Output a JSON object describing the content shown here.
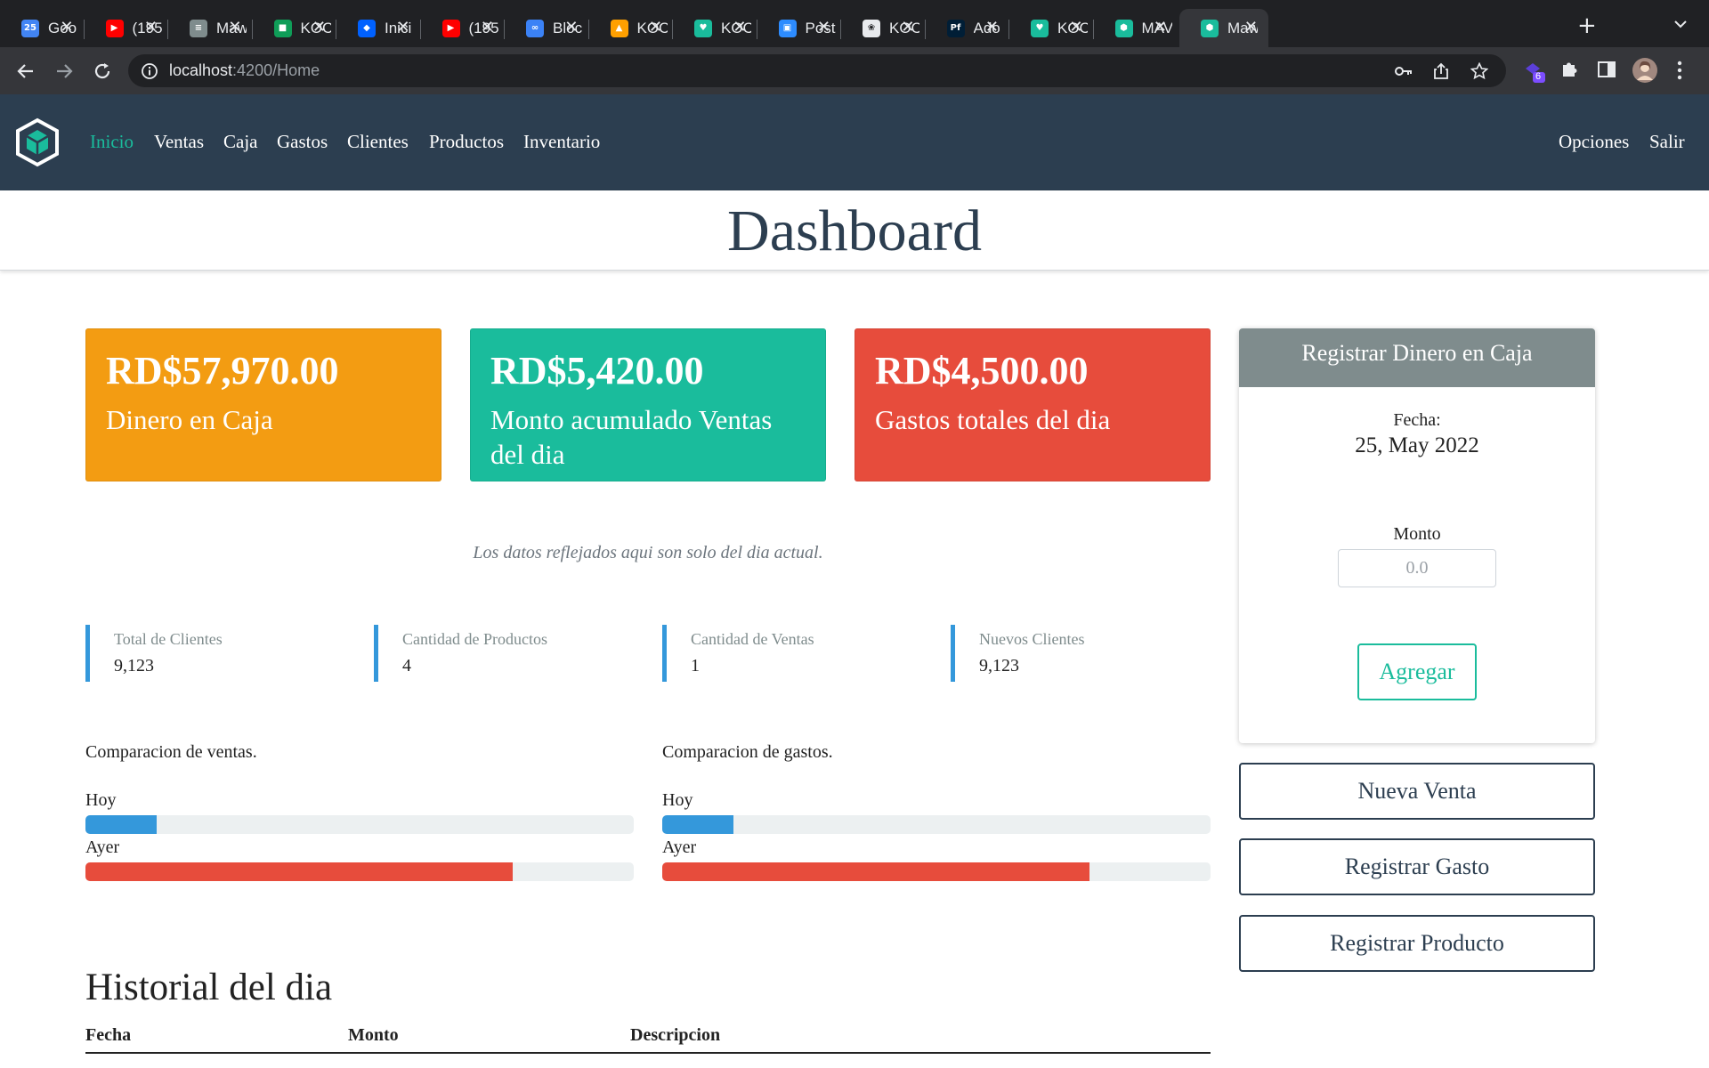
{
  "browser": {
    "tabs": [
      {
        "title": "Goo",
        "icon": "calendar-icon",
        "color": "#4285f4"
      },
      {
        "title": "(195",
        "icon": "youtube-icon",
        "color": "#ff0000"
      },
      {
        "title": "Maw",
        "icon": "app-icon",
        "color": "#7f8c8d"
      },
      {
        "title": "KOC",
        "icon": "sheet-icon",
        "color": "#0f9d58"
      },
      {
        "title": "Inici",
        "icon": "dropbox-icon",
        "color": "#0061ff"
      },
      {
        "title": "(195",
        "icon": "youtube-icon",
        "color": "#ff0000"
      },
      {
        "title": "Bloc",
        "icon": "meta-icon",
        "color": "#3b82f6"
      },
      {
        "title": "KOC",
        "icon": "firebase-icon",
        "color": "#ffa000"
      },
      {
        "title": "KOC",
        "icon": "heart-icon",
        "color": "#1abc9c"
      },
      {
        "title": "Post",
        "icon": "zoom-icon",
        "color": "#2d8cff"
      },
      {
        "title": "KOC",
        "icon": "openai-icon",
        "color": "#e8eaed"
      },
      {
        "title": "Ado",
        "icon": "pf-icon",
        "color": "#001e36"
      },
      {
        "title": "KOC",
        "icon": "heart-icon",
        "color": "#1abc9c"
      },
      {
        "title": "MAV",
        "icon": "cube-icon",
        "color": "#1abc9c"
      },
      {
        "title": "Maw",
        "icon": "cube-icon",
        "color": "#1abc9c"
      }
    ],
    "url_host": "localhost",
    "url_path": ":4200/Home",
    "extension_badge": "6"
  },
  "nav": {
    "links": [
      "Inicio",
      "Ventas",
      "Caja",
      "Gastos",
      "Clientes",
      "Productos",
      "Inventario"
    ],
    "right_links": [
      "Opciones",
      "Salir"
    ],
    "active_color": "#1abc9c",
    "bg_color": "#2c3e50"
  },
  "dashboard": {
    "title": "Dashboard",
    "cards": [
      {
        "amount": "RD$57,970.00",
        "label": "Dinero en Caja",
        "color": "#f39c12"
      },
      {
        "amount": "RD$5,420.00",
        "label": "Monto acumulado Ventas del dia",
        "color": "#1abc9c"
      },
      {
        "amount": "RD$4,500.00",
        "label": "Gastos totales del dia",
        "color": "#e74c3c"
      }
    ],
    "note": "Los datos reflejados aqui son solo del dia actual.",
    "metrics": [
      {
        "label": "Total de Clientes",
        "value": "9,123"
      },
      {
        "label": "Cantidad de Productos",
        "value": "4"
      },
      {
        "label": "Cantidad de Ventas",
        "value": "1"
      },
      {
        "label": "Nuevos Clientes",
        "value": "9,123"
      }
    ],
    "comparisons": [
      {
        "title": "Comparacion de ventas.",
        "today_label": "Hoy",
        "today_fraction": 0.13,
        "yesterday_label": "Ayer",
        "yesterday_fraction": 0.78
      },
      {
        "title": "Comparacion de gastos.",
        "today_label": "Hoy",
        "today_fraction": 0.13,
        "yesterday_label": "Ayer",
        "yesterday_fraction": 0.78
      }
    ],
    "colors": {
      "today": "#3498db",
      "yesterday": "#e74c3c",
      "track": "#ecf0f1"
    },
    "history": {
      "title": "Historial del dia",
      "columns": [
        "Fecha",
        "Monto",
        "Descripcion"
      ]
    }
  },
  "panel": {
    "title": "Registrar Dinero en Caja",
    "fecha_label": "Fecha:",
    "fecha_value": "25, May 2022",
    "monto_label": "Monto",
    "monto_placeholder": "0.0",
    "agregar_label": "Agregar"
  },
  "actions": [
    "Nueva Venta",
    "Registrar Gasto",
    "Registrar Producto"
  ]
}
